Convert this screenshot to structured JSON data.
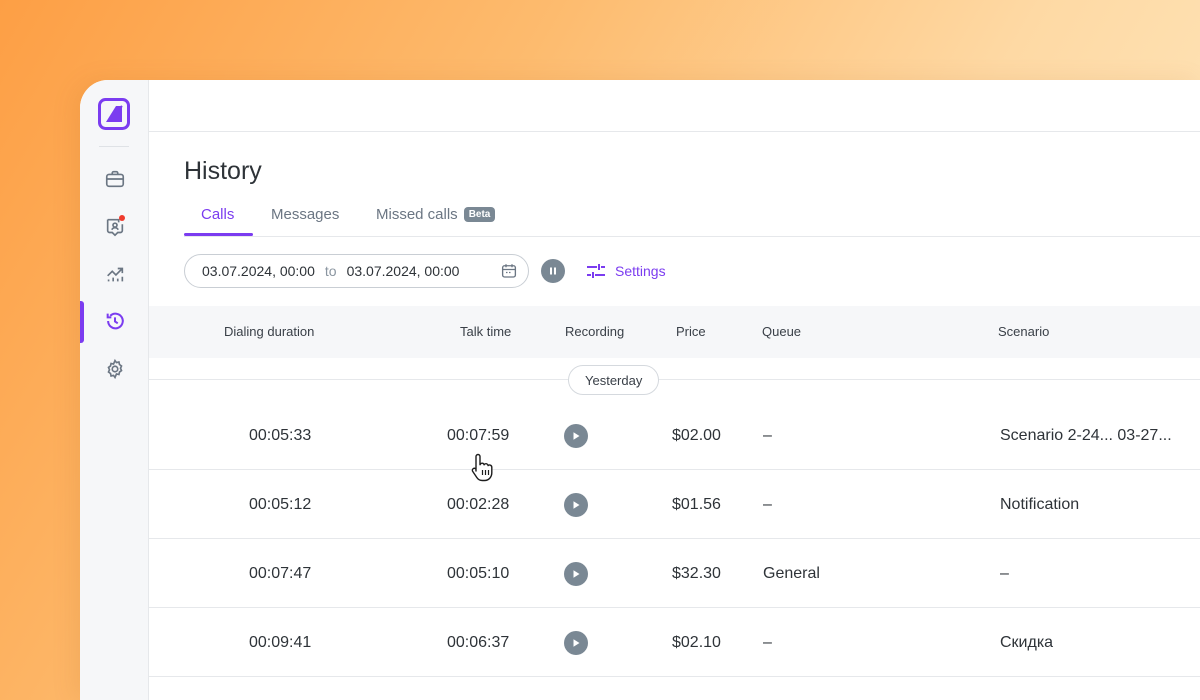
{
  "colors": {
    "accent": "#7b3cf0",
    "muted_icon": "#7a8894",
    "notification_dot": "#ef3b2d"
  },
  "sidebar": {
    "items": [
      {
        "icon": "briefcase-icon",
        "active": false
      },
      {
        "icon": "contacts-icon",
        "active": false,
        "badge": true
      },
      {
        "icon": "analytics-icon",
        "active": false
      },
      {
        "icon": "history-icon",
        "active": true
      },
      {
        "icon": "gear-icon",
        "active": false
      }
    ]
  },
  "page": {
    "title": "History"
  },
  "tabs": [
    {
      "label": "Calls",
      "active": true
    },
    {
      "label": "Messages",
      "active": false
    },
    {
      "label": "Missed calls",
      "active": false,
      "badge": "Beta"
    }
  ],
  "filter": {
    "from": "03.07.2024, 00:00",
    "to_label": "to",
    "to": "03.07.2024, 00:00",
    "settings_label": "Settings"
  },
  "table": {
    "headers": {
      "dialing_duration": "Dialing duration",
      "talk_time": "Talk time",
      "recording": "Recording",
      "price": "Price",
      "queue": "Queue",
      "scenario": "Scenario"
    },
    "group_label": "Yesterday",
    "rows": [
      {
        "dialing": "00:05:33",
        "talk": "00:07:59",
        "price": "$02.00",
        "queue": "–",
        "scenario": "Scenario 2-24... 03-27..."
      },
      {
        "dialing": "00:05:12",
        "talk": "00:02:28",
        "price": "$01.56",
        "queue": "–",
        "scenario": "Notification"
      },
      {
        "dialing": "00:07:47",
        "talk": "00:05:10",
        "price": "$32.30",
        "queue": "General",
        "scenario": "–"
      },
      {
        "dialing": "00:09:41",
        "talk": "00:06:37",
        "price": "$02.10",
        "queue": "–",
        "scenario": "Скидка"
      }
    ]
  }
}
